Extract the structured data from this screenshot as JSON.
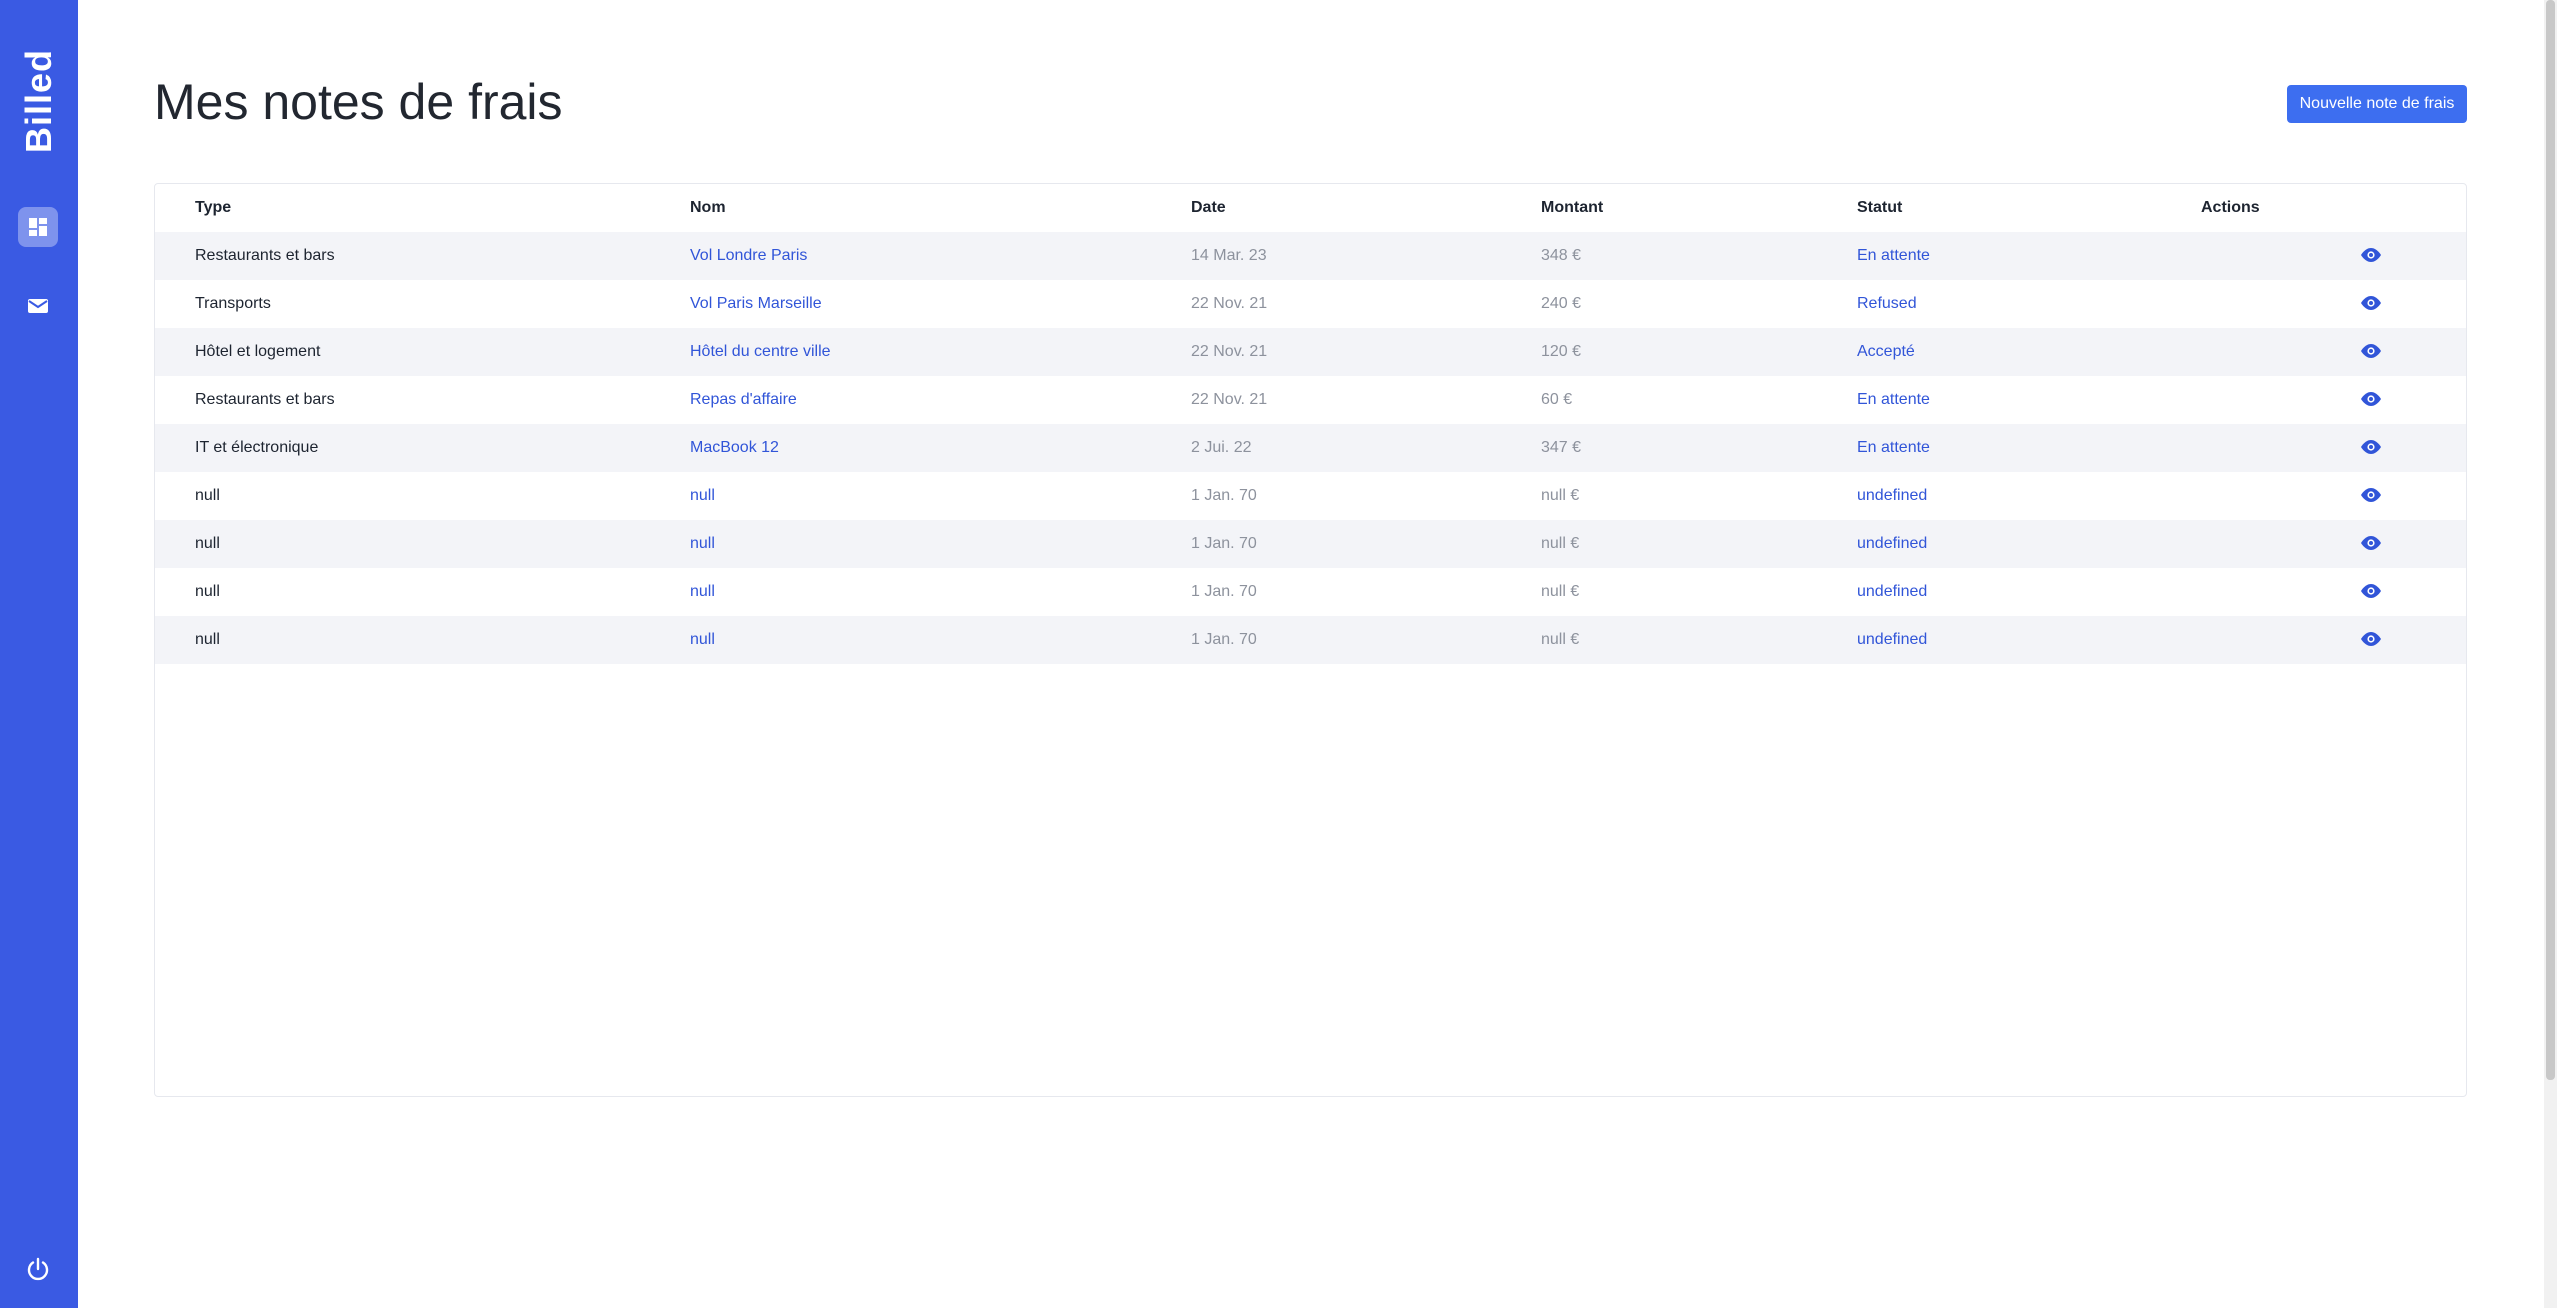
{
  "app": {
    "brand": "Billed"
  },
  "sidebar": {
    "icons": [
      "dashboard-icon",
      "mail-icon",
      "power-icon"
    ],
    "accent": "#3a5ae3"
  },
  "page": {
    "title": "Mes notes de frais",
    "new_button_label": "Nouvelle note de frais"
  },
  "table": {
    "headers": {
      "type": "Type",
      "name": "Nom",
      "date": "Date",
      "amount": "Montant",
      "status": "Statut",
      "actions": "Actions"
    },
    "rows": [
      {
        "type": "Restaurants et bars",
        "name": "Vol Londre Paris",
        "date": "14 Mar. 23",
        "amount": "348 €",
        "status": "En attente"
      },
      {
        "type": "Transports",
        "name": "Vol Paris Marseille",
        "date": "22 Nov. 21",
        "amount": "240 €",
        "status": "Refused"
      },
      {
        "type": "Hôtel et logement",
        "name": "Hôtel du centre ville",
        "date": "22 Nov. 21",
        "amount": "120 €",
        "status": "Accepté"
      },
      {
        "type": "Restaurants et bars",
        "name": "Repas d'affaire",
        "date": "22 Nov. 21",
        "amount": "60 €",
        "status": "En attente"
      },
      {
        "type": "IT et électronique",
        "name": "MacBook 12",
        "date": "2 Jui. 22",
        "amount": "347 €",
        "status": "En attente"
      },
      {
        "type": "null",
        "name": "null",
        "date": "1 Jan. 70",
        "amount": "null €",
        "status": "undefined"
      },
      {
        "type": "null",
        "name": "null",
        "date": "1 Jan. 70",
        "amount": "null €",
        "status": "undefined"
      },
      {
        "type": "null",
        "name": "null",
        "date": "1 Jan. 70",
        "amount": "null €",
        "status": "undefined"
      },
      {
        "type": "null",
        "name": "null",
        "date": "1 Jan. 70",
        "amount": "null €",
        "status": "undefined"
      }
    ],
    "action_icon": "eye-icon"
  }
}
